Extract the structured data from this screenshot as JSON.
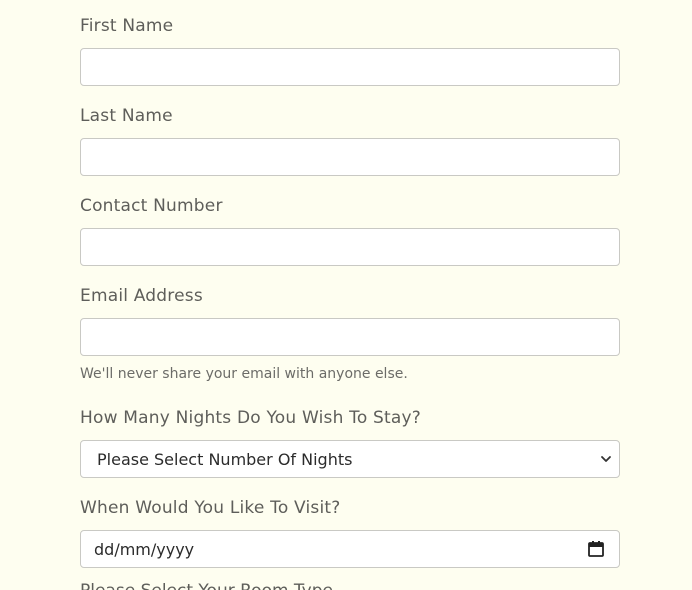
{
  "form": {
    "first_name": {
      "label": "First Name",
      "value": ""
    },
    "last_name": {
      "label": "Last Name",
      "value": ""
    },
    "contact_number": {
      "label": "Contact Number",
      "value": ""
    },
    "email": {
      "label": "Email Address",
      "value": "",
      "help": "We'll never share your email with anyone else."
    },
    "nights": {
      "label": "How Many Nights Do You Wish To Stay?",
      "selected": "Please Select Number Of Nights"
    },
    "visit_date": {
      "label": "When Would You Like To Visit?",
      "placeholder": "dd/mm/yyyy"
    },
    "next_label_partial": "Please Select Your Room Type..."
  }
}
